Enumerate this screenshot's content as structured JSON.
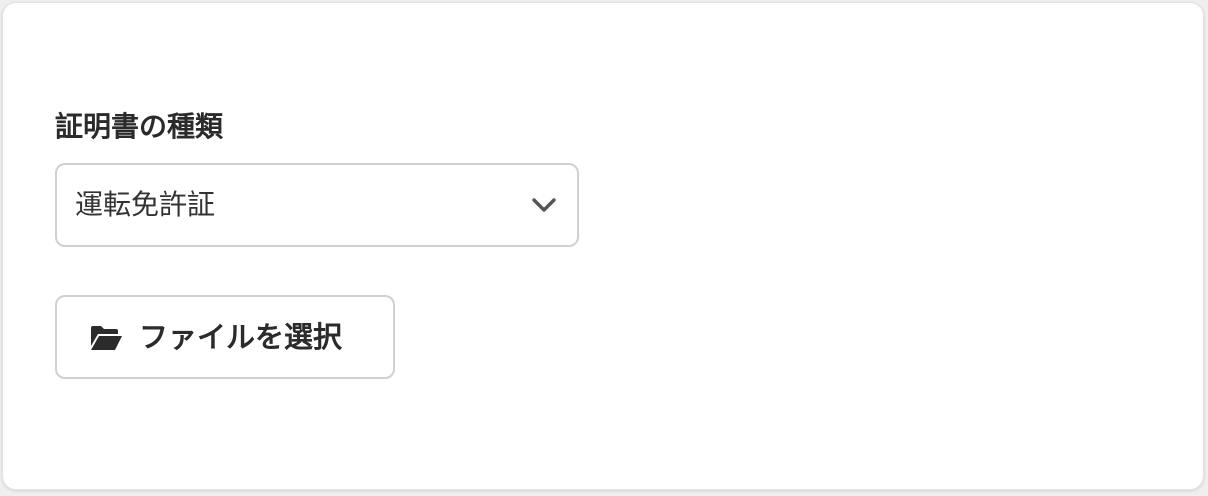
{
  "form": {
    "document_type_label": "証明書の種類",
    "document_type_select": {
      "selected": "運転免許証",
      "icon": "chevron-down-icon"
    },
    "file_button": {
      "label": "ファイルを選択",
      "icon": "folder-open-icon"
    }
  },
  "colors": {
    "card_background": "#ffffff",
    "border": "#d0d0d0",
    "text": "#2b2b2b",
    "icon": "#555555"
  }
}
